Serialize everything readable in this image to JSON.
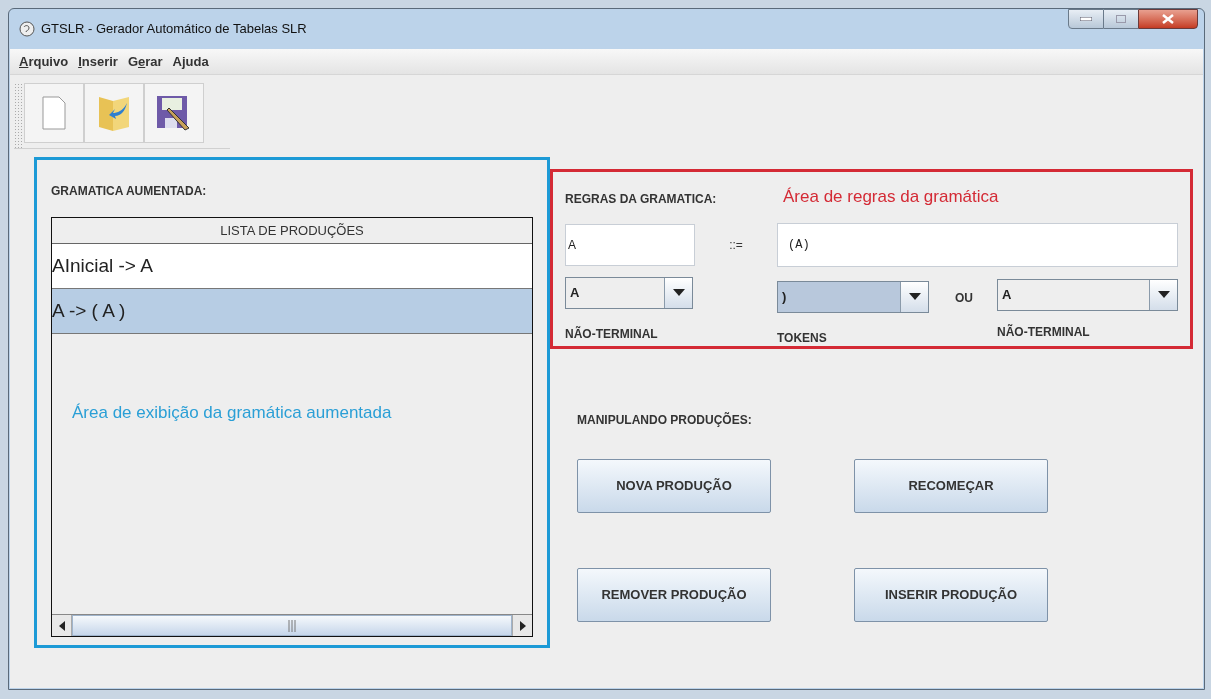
{
  "window": {
    "title": "GTSLR - Gerador Automático de Tabelas SLR"
  },
  "menu": [
    {
      "mnemonic": "A",
      "rest": "rquivo"
    },
    {
      "mnemonic": "I",
      "rest": "nserir"
    },
    {
      "lead": "G",
      "mnemonic": "e",
      "rest": "rar"
    },
    {
      "rest": "Ajuda"
    }
  ],
  "grammar_panel": {
    "title": "GRAMATICA AUMENTADA:",
    "list_header": "LISTA DE PRODUÇÕES",
    "rows": [
      {
        "text": "AInicial -> A",
        "selected": false
      },
      {
        "text": "A ->  ( A )",
        "selected": true
      }
    ],
    "annotation": "Área de exibição da gramática aumentada"
  },
  "rules_panel": {
    "title": "REGRAS DA GRAMATICA:",
    "annotation": "Área de regras da gramática",
    "lhs_value": "A",
    "separator": "::=",
    "rhs_value": "(A)",
    "nonterminal": {
      "value": "A",
      "caption": "NÃO-TERMINAL",
      "focused": false
    },
    "tokens": {
      "value": ")",
      "caption": "TOKENS",
      "focused": true
    },
    "or_label": "OU",
    "nonterminal_2": {
      "value": "A",
      "caption": "NÃO-TERMINAL",
      "focused": false
    }
  },
  "productions": {
    "title": "MANIPULANDO PRODUÇÕES:",
    "buttons": [
      "NOVA PRODUÇÃO",
      "RECOMEÇAR",
      "REMOVER PRODUÇÃO",
      "INSERIR PRODUÇÃO"
    ]
  }
}
